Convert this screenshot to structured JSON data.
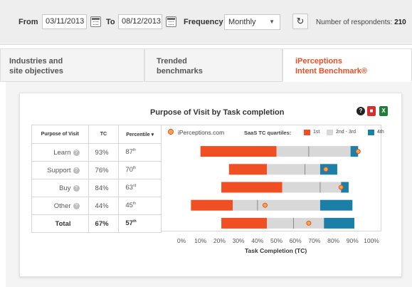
{
  "filters": {
    "from_label": "From",
    "from_date": "03/11/2013",
    "to_label": "To",
    "to_date": "08/12/2013",
    "frequency_label": "Frequency",
    "frequency_value": "Monthly",
    "respondents_label": "Number of respondents:",
    "respondents_value": "210"
  },
  "tabs": [
    {
      "line1": "Industries and",
      "line2": "site objectives"
    },
    {
      "line1": "Trended",
      "line2": "benchmarks"
    },
    {
      "line1": "iPerceptions",
      "line2": "Intent Benchmark®"
    }
  ],
  "table": {
    "headers": [
      "Purpose of Visit",
      "TC",
      "Percentile ▾"
    ],
    "rows": [
      {
        "label": "Learn",
        "tc": "93%",
        "pct": "87",
        "sup": "th"
      },
      {
        "label": "Support",
        "tc": "76%",
        "pct": "70",
        "sup": "th"
      },
      {
        "label": "Buy",
        "tc": "84%",
        "pct": "63",
        "sup": "rd"
      },
      {
        "label": "Other",
        "tc": "44%",
        "pct": "45",
        "sup": "th"
      }
    ],
    "total": {
      "label": "Total",
      "tc": "67%",
      "pct": "57",
      "sup": "th"
    }
  },
  "legend": {
    "marker_label": "iPerceptions.com",
    "quartiles_label": "SaaS TC quartiles:",
    "q1": "1st",
    "q23": "2nd - 3rd",
    "q4": "4th"
  },
  "colors": {
    "q1": "#f04e23",
    "q23": "#d8d8d8",
    "q4": "#1b7fa8",
    "marker": "#f5a84a",
    "accent": "#f04e23"
  },
  "chart_data": {
    "type": "bar",
    "title": "Purpose of Visit by Task completion",
    "xlabel": "Task Completion (TC)",
    "xlim": [
      0,
      100
    ],
    "xticks": [
      "0%",
      "10%",
      "20%",
      "30%",
      "40%",
      "50%",
      "60%",
      "70%",
      "80%",
      "90%",
      "100%"
    ],
    "categories": [
      "Learn",
      "Support",
      "Buy",
      "Other",
      "Total"
    ],
    "series": [
      {
        "name": "1st",
        "values": [
          [
            10,
            50
          ],
          [
            25,
            45
          ],
          [
            21,
            53
          ],
          [
            5,
            27
          ],
          [
            21,
            45
          ]
        ]
      },
      {
        "name": "2nd - 3rd",
        "values": [
          [
            50,
            89
          ],
          [
            45,
            73
          ],
          [
            53,
            84
          ],
          [
            27,
            73
          ],
          [
            45,
            75
          ]
        ]
      },
      {
        "name": "4th",
        "values": [
          [
            89,
            93
          ],
          [
            73,
            82
          ],
          [
            84,
            88
          ],
          [
            73,
            90
          ],
          [
            75,
            91
          ]
        ]
      }
    ],
    "medians": [
      67,
      65,
      73,
      40,
      59
    ],
    "site_marker": [
      93,
      76,
      84,
      44,
      67
    ]
  }
}
